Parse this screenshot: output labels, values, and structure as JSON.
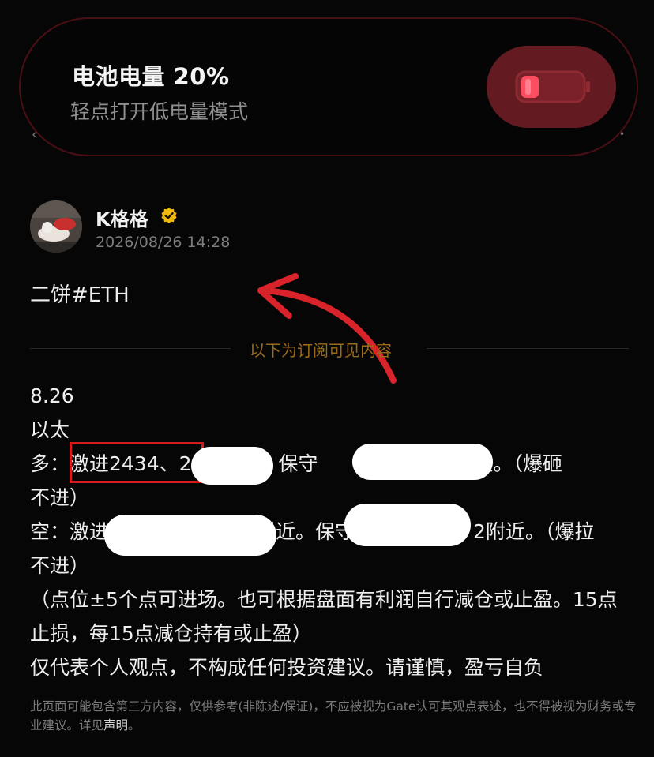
{
  "notification": {
    "title": "电池电量 20%",
    "subtitle": "轻点打开低电量模式",
    "battery_icon": "battery-low-icon",
    "accent_color": "#f0364a",
    "button_color": "#631a20"
  },
  "post": {
    "author": "K格格",
    "verified_icon": "verified-badge-icon",
    "timestamp": "2026/08/26 14:28",
    "title": "二饼#ETH",
    "subscriber_divider": "以下为订阅可见内容",
    "lines": [
      "8.26",
      "以太",
      "多：激进2434、2",
      "近。保守",
      "附近。（爆砸",
      "不进）",
      "空：激进",
      "附近。保守",
      "2附近。（爆拉",
      "不进）",
      "（点位±5个点可进场。也可根据盘面有利润自行减仓或止盈。15点止损，每15点减仓持有或止盈）",
      "仅代表个人观点，不构成任何投资建议。请谨慎，盈亏自负"
    ]
  },
  "disclaimer": {
    "text": "此页面可能包含第三方内容，仅供参考(非陈述/保证)，不应被视为Gate认可其观点表述，也不得被视为财务或专业建议。详见",
    "link": "声明",
    "end": "。"
  },
  "colors": {
    "background": "#060606",
    "divider_text": "#9a6a18",
    "annotation_red": "#d51c1c",
    "verified_gold": "#f0b90b"
  }
}
